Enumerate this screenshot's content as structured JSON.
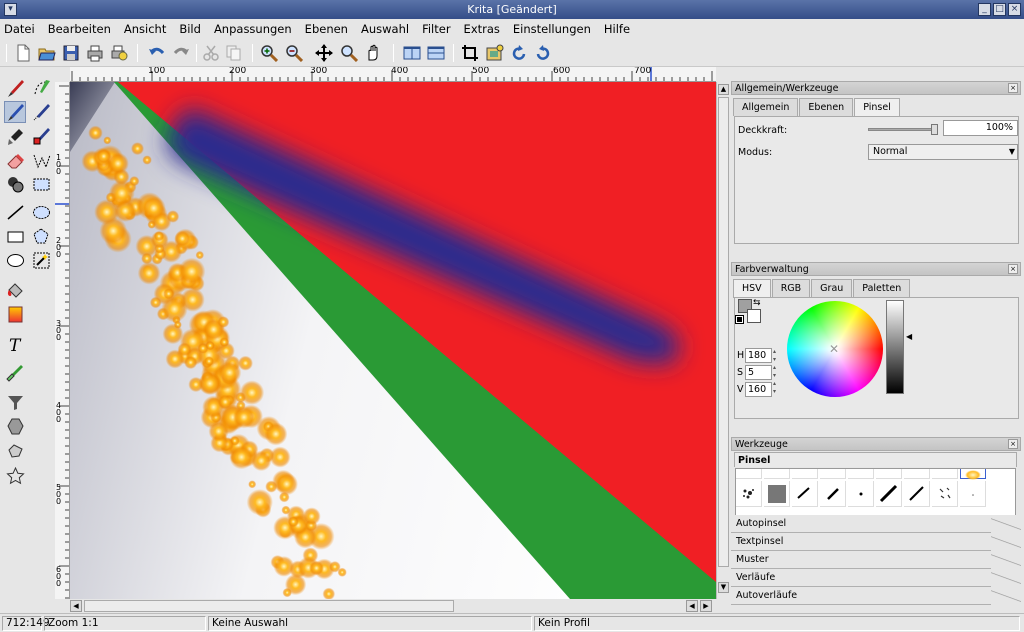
{
  "window": {
    "title": "Krita [Geändert]"
  },
  "menu": [
    "Datei",
    "Bearbeiten",
    "Ansicht",
    "Bild",
    "Anpassungen",
    "Ebenen",
    "Auswahl",
    "Filter",
    "Extras",
    "Einstellungen",
    "Hilfe"
  ],
  "toolbar": {
    "icons": [
      "new-document-icon",
      "open-icon",
      "save-icon",
      "print-icon",
      "print-preview-icon",
      "undo-icon",
      "redo-icon",
      "cut-icon",
      "copy-icon",
      "zoom-in-icon",
      "zoom-out-icon",
      "move-icon",
      "zoom-icon",
      "pan-icon",
      "view-split-vertical-icon",
      "view-split-horizontal-icon",
      "crop-icon",
      "image-properties-icon",
      "rotate-ccw-icon",
      "rotate-cw-icon"
    ]
  },
  "tools": [
    "brush-tool",
    "freehand-selection-tool",
    "airbrush-tool",
    "polygon-selection-tool",
    "stamp-tool",
    "color-picker-selection-tool",
    "eraser-tool",
    "path-tool",
    "duplicate-tool",
    "rect-select-tool",
    "line-tool",
    "ellipse-select-tool",
    "rectangle-tool",
    "polygon-select-tool",
    "ellipse-tool",
    "magic-wand-tool",
    "fill-tool",
    "gradient-tool",
    "text-tool",
    "color-picker-tool",
    "funnel-tool",
    "polygon-tool",
    "shape-tool",
    "star-tool"
  ],
  "ruler": {
    "h_labels": [
      "100",
      "200",
      "300",
      "400",
      "500",
      "600",
      "700"
    ],
    "v_labels": [
      "100",
      "200",
      "300",
      "400",
      "500",
      "600"
    ]
  },
  "status": {
    "coords": "712:149",
    "zoom": "Zoom 1:1",
    "selection": "Keine Auswahl",
    "profile": "Kein Profil"
  },
  "general_dock": {
    "title": "Allgemein/Werkzeuge",
    "tabs": [
      "Allgemein",
      "Ebenen",
      "Pinsel"
    ],
    "opacity_label": "Deckkraft:",
    "opacity_value": "100%",
    "opacity_level": 1.0,
    "mode_label": "Modus:",
    "mode_value": "Normal"
  },
  "color_dock": {
    "title": "Farbverwaltung",
    "tabs": [
      "HSV",
      "RGB",
      "Grau",
      "Paletten"
    ],
    "h_label": "H",
    "h_value": "180",
    "s_label": "S",
    "s_value": "5",
    "v_label": "V",
    "v_value": "160"
  },
  "tools_dock": {
    "title": "Werkzeuge",
    "pinsel_label": "Pinsel",
    "drawers": [
      "Autopinsel",
      "Textpinsel",
      "Muster",
      "Verläufe",
      "Autoverläufe"
    ]
  },
  "colors": {
    "red": "#f01f24",
    "blue": "#2a2a8e",
    "green": "#2a9a35",
    "orange": "#ffaa00",
    "title_bg": "#3b5590"
  }
}
